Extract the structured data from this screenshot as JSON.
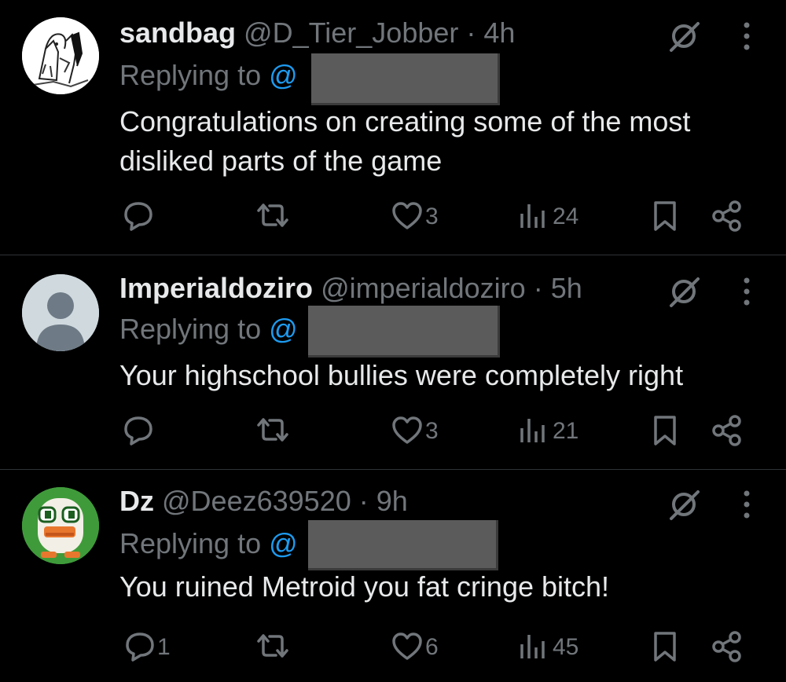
{
  "colors": {
    "background": "#000000",
    "text_primary": "#e7e9ea",
    "text_secondary": "#71767b",
    "link": "#1d9bf0",
    "divider": "#2f3336",
    "redaction": "#5b5b5b"
  },
  "tweets": [
    {
      "display_name": "sandbag",
      "handle": "@D_Tier_Jobber",
      "separator": "·",
      "time": "4h",
      "replying_to_label": "Replying to",
      "replying_to_at": "@",
      "text": "Congratulations on creating some of the most disliked parts of the game",
      "reply_count": "",
      "like_count": "3",
      "view_count": "24",
      "avatar_icon": "manga-drawing-avatar",
      "grok-icon": "grok-icon",
      "more_icon": "more-icon"
    },
    {
      "display_name": "Imperialdoziro",
      "handle": "@imperialdoziro",
      "separator": "·",
      "time": "5h",
      "replying_to_label": "Replying to",
      "replying_to_at": "@",
      "text": "Your highschool bullies were completely right",
      "reply_count": "",
      "like_count": "3",
      "view_count": "21",
      "avatar_icon": "default-person-avatar"
    },
    {
      "display_name": "Dz",
      "handle": "@Deez639520",
      "separator": "·",
      "time": "9h",
      "replying_to_label": "Replying to",
      "replying_to_at": "@",
      "text": "You ruined Metroid you fat cringe bitch!",
      "reply_count": "1",
      "like_count": "6",
      "view_count": "45",
      "avatar_icon": "pixel-duck-avatar"
    }
  ]
}
